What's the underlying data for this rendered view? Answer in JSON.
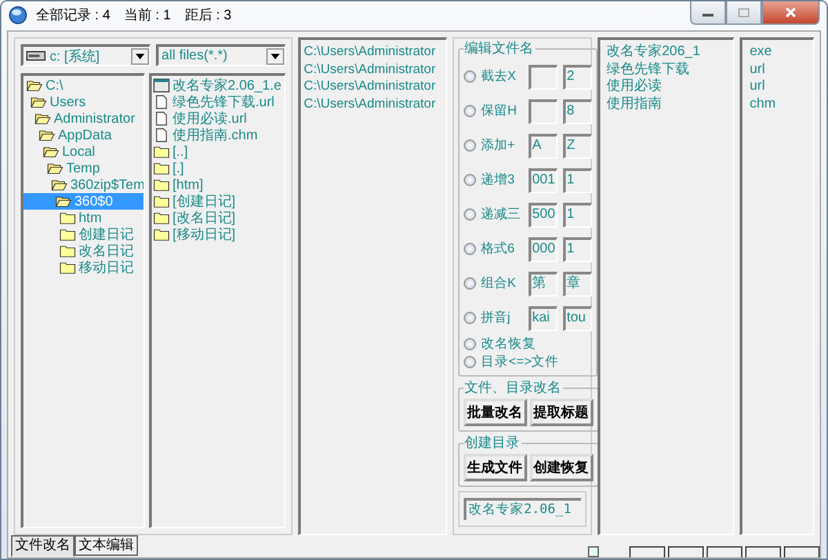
{
  "window": {
    "stats": [
      "全部记录 : 4",
      "当前 : 1",
      "距后 : 3"
    ]
  },
  "drive_select": {
    "value": "c: [系统]"
  },
  "filter_select": {
    "value": "all files(*.*)"
  },
  "folder_tree": [
    {
      "label": "C:\\",
      "expanded": true,
      "selected": false,
      "children": [
        {
          "label": "Users",
          "expanded": true,
          "selected": false,
          "children": [
            {
              "label": "Administrator",
              "expanded": true,
              "selected": false,
              "children": [
                {
                  "label": "AppData",
                  "expanded": true,
                  "selected": false,
                  "children": [
                    {
                      "label": "Local",
                      "expanded": true,
                      "selected": false,
                      "children": [
                        {
                          "label": "Temp",
                          "expanded": true,
                          "selected": false,
                          "children": [
                            {
                              "label": "360zip$Tem",
                              "expanded": true,
                              "selected": false,
                              "children": [
                                {
                                  "label": "360$0",
                                  "expanded": true,
                                  "selected": true,
                                  "children": [
                                    {
                                      "label": "htm",
                                      "expanded": false,
                                      "selected": false
                                    },
                                    {
                                      "label": "创建日记",
                                      "expanded": false,
                                      "selected": false
                                    },
                                    {
                                      "label": "改名日记",
                                      "expanded": false,
                                      "selected": false
                                    },
                                    {
                                      "label": "移动日记",
                                      "expanded": false,
                                      "selected": false
                                    }
                                  ]
                                }
                              ]
                            }
                          ]
                        }
                      ]
                    }
                  ]
                }
              ]
            }
          ]
        }
      ]
    }
  ],
  "file_list": [
    {
      "kind": "program",
      "label": "改名专家2.06_1.e"
    },
    {
      "kind": "file",
      "label": "绿色先锋下载.url"
    },
    {
      "kind": "file",
      "label": "使用必读.url"
    },
    {
      "kind": "file",
      "label": "使用指南.chm"
    },
    {
      "kind": "folder",
      "label": "[..]"
    },
    {
      "kind": "folder",
      "label": "[.]"
    },
    {
      "kind": "folder",
      "label": "[htm]"
    },
    {
      "kind": "folder",
      "label": "[创建日记]"
    },
    {
      "kind": "folder",
      "label": "[改名日记]"
    },
    {
      "kind": "folder",
      "label": "[移动日记]"
    }
  ],
  "path_list": [
    "C:\\Users\\Administrator",
    "C:\\Users\\Administrator",
    "C:\\Users\\Administrator",
    "C:\\Users\\Administrator"
  ],
  "rename_group": {
    "title": "编辑文件名",
    "options": [
      {
        "kind": "fields",
        "label": "截去X",
        "selected": false,
        "field_2": "2"
      },
      {
        "kind": "fields",
        "label": "保留H",
        "selected": false,
        "field_2": "8"
      },
      {
        "kind": "fields",
        "label": "添加+",
        "selected": false,
        "field_1": "A",
        "field_2": "Z"
      },
      {
        "kind": "fields",
        "label": "递增3",
        "selected": false,
        "field_1": "001",
        "field_2": "1"
      },
      {
        "kind": "fields",
        "label": "递减三",
        "selected": false,
        "field_1": "500",
        "field_2": "1"
      },
      {
        "kind": "fields",
        "label": "格式6",
        "selected": false,
        "field_1": "000",
        "field_2": "1"
      },
      {
        "kind": "fields",
        "label": "组合K",
        "selected": false,
        "field_1": "第",
        "field_2": "章"
      },
      {
        "kind": "fields",
        "label": "拼音j",
        "selected": false,
        "field_1": "kai",
        "field_2": "tou"
      },
      {
        "kind": "plain",
        "label": "改名恢复",
        "selected": false
      },
      {
        "kind": "plain",
        "label": "目录<=>文件",
        "selected": false
      }
    ]
  },
  "file_dir_group": {
    "title": "文件、目录改名",
    "buttons": [
      "批量改名",
      "提取标题"
    ]
  },
  "create_dir_group": {
    "title": "创建目录",
    "buttons": [
      "生成文件",
      "创建恢复"
    ]
  },
  "name_field": {
    "value": "改名专家2.06_1"
  },
  "name_list": [
    "改名专家206_1",
    "绿色先锋下载",
    "使用必读",
    "使用指南"
  ],
  "extension_list": [
    "exe",
    "url",
    "url",
    "chm"
  ],
  "tabs": [
    {
      "label": "文件改名",
      "selected": true
    },
    {
      "label": "文本编辑",
      "selected": false
    }
  ],
  "status_bar": {
    "mode_checked": false
  }
}
